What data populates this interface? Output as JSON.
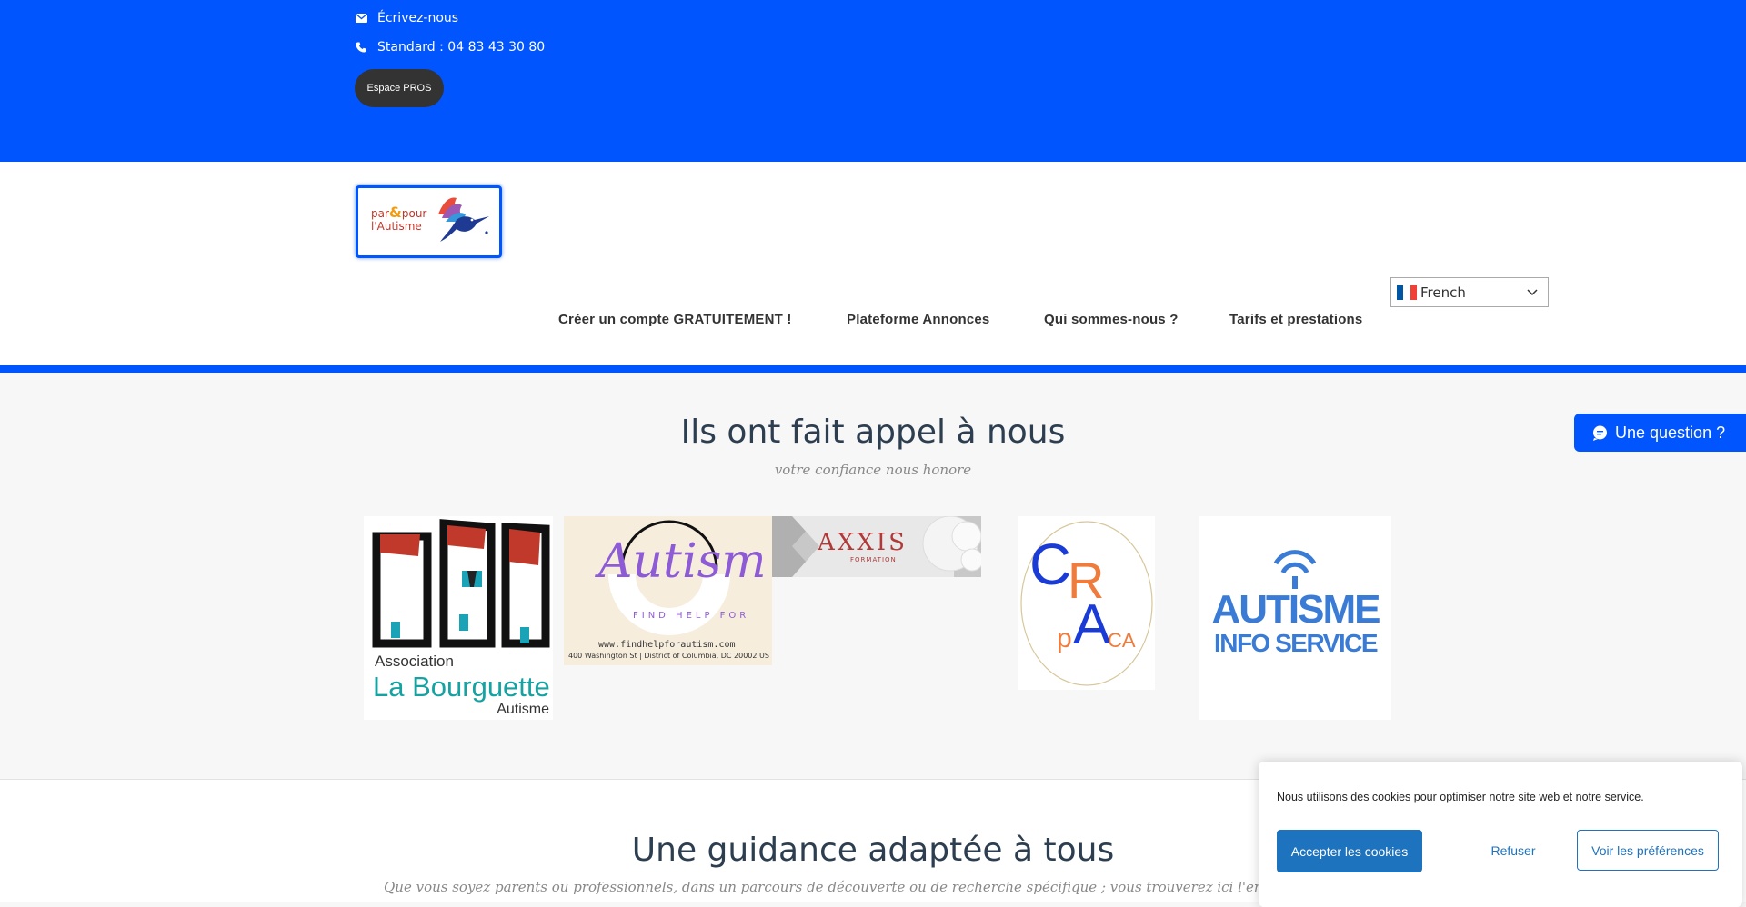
{
  "topbar": {
    "write_label": "Écrivez-nous",
    "phone_label": "Standard : 04 83 43 30 80",
    "pros_button": "Espace PROS",
    "email_icon": "envelope-icon",
    "phone_icon": "phone-icon"
  },
  "logo": {
    "line1_a": "par",
    "amp": "&",
    "line1_b": "pour",
    "line2": "l'Autisme",
    "bird_icon": "hummingbird-icon"
  },
  "language": {
    "selected": "French",
    "flag_icon": "france-flag-icon"
  },
  "nav": {
    "items": [
      {
        "label": "Créer un compte GRATUITEMENT !"
      },
      {
        "label": "Plateforme Annonces"
      },
      {
        "label": "Qui sommes-nous ?"
      },
      {
        "label": "Tarifs et prestations"
      }
    ]
  },
  "clients_section": {
    "title": "Ils ont fait appel à nous",
    "subtitle": "votre confiance nous honore",
    "logos": {
      "bourguette": {
        "line1": "Association",
        "line2": "La Bourguette",
        "line3": "Autisme"
      },
      "findhelp": {
        "script": "Autism",
        "arc": "FIND HELP FOR",
        "url": "www.findhelpforautism.com",
        "address": "400 Washington St | District of Columbia, DC 20002 US"
      },
      "axxis": {
        "name": "AXXIS",
        "sub": "FORMATION"
      },
      "cra": {
        "c": "C",
        "r": "R",
        "a": "A",
        "p": "p",
        "ca": "CA"
      },
      "autisme_info": {
        "line1": "AUTISME",
        "line2": "INFO SERVICE"
      }
    }
  },
  "guidance_section": {
    "title": "Une guidance adaptée à tous",
    "subtitle": "Que vous soyez parents ou professionnels, dans un parcours de découverte ou de recherche spécifique ; vous trouverez ici l'ensemble des stratégies p"
  },
  "question_tab": {
    "label": "Une question ?",
    "icon": "chat-bubble-icon"
  },
  "cookie_banner": {
    "text": "Nous utilisons des cookies pour optimiser notre site web et notre service.",
    "accept": "Accepter les cookies",
    "refuse": "Refuser",
    "preferences": "Voir les préférences"
  },
  "colors": {
    "brand_blue": "#0055ff",
    "cookie_blue": "#1e73be",
    "dark_button": "#333333"
  }
}
